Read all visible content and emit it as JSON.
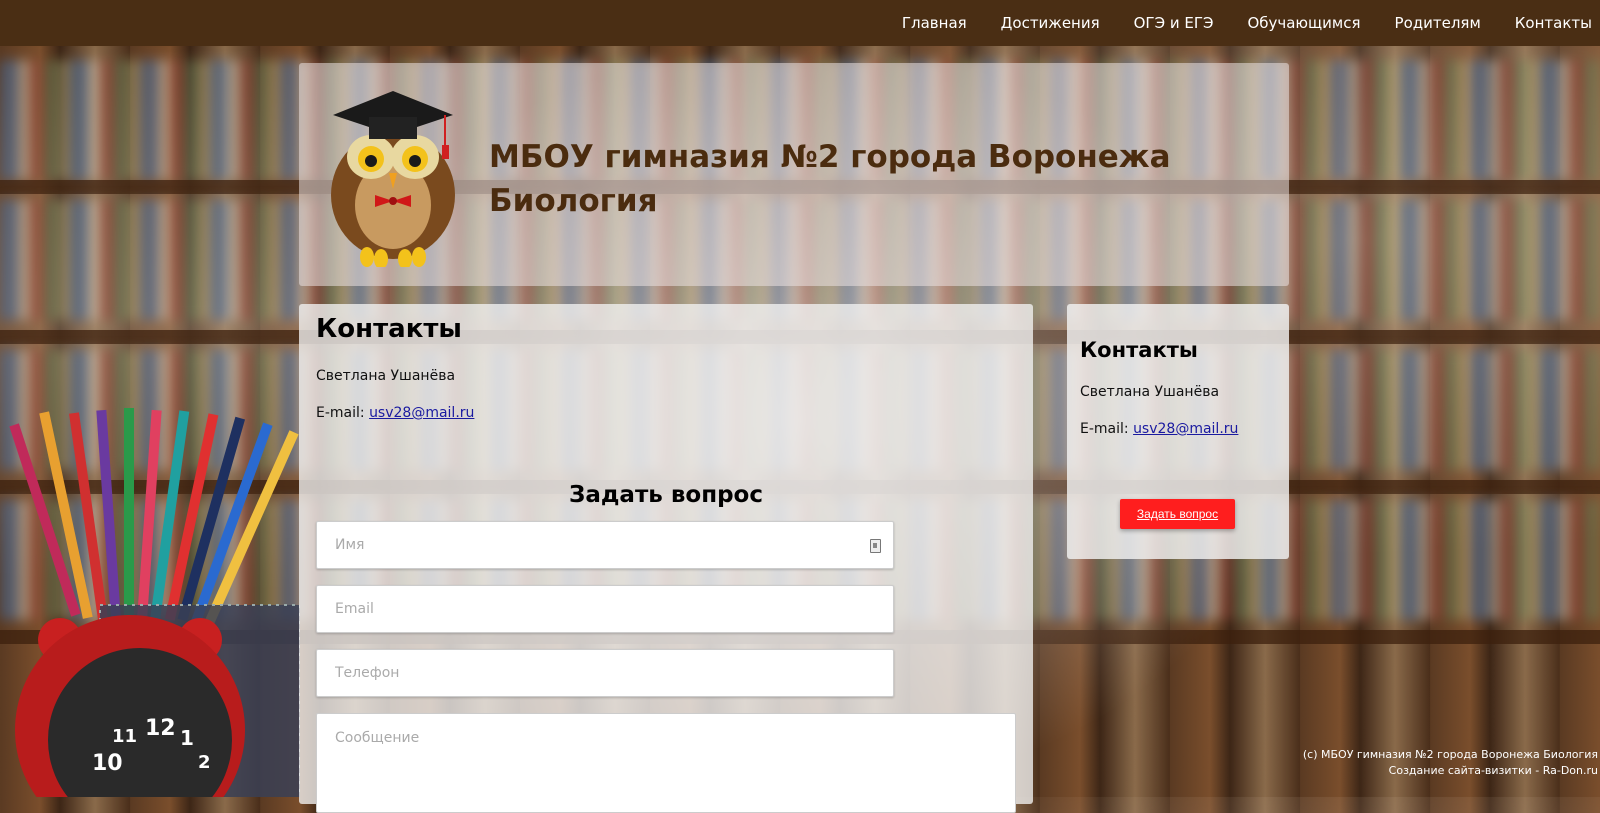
{
  "nav": {
    "items": [
      "Главная",
      "Достижения",
      "ОГЭ и ЕГЭ",
      "Обучающимся",
      "Родителям",
      "Контакты"
    ]
  },
  "header": {
    "title_line1": "МБОУ гимназия №2 города Воронежа",
    "title_line2": "Биология"
  },
  "main": {
    "heading": "Контакты",
    "name": "Светлана Ушанёва",
    "email_label": "E-mail: ",
    "email": "usv28@mail.ru",
    "form": {
      "title": "Задать вопрос",
      "name_placeholder": "Имя",
      "email_placeholder": "Email",
      "phone_placeholder": "Телефон",
      "message_placeholder": "Сообщение"
    }
  },
  "sidebar": {
    "heading": "Контакты",
    "name": "Светлана Ушанёва",
    "email_label": "E-mail: ",
    "email": "usv28@mail.ru",
    "button": "Задать вопрос"
  },
  "footer": {
    "line1": "(c) МБОУ гимназия №2 города Воронежа Биология",
    "line2": "Создание сайта-визитки - Ra-Don.ru"
  },
  "colors": {
    "nav_bg": "#4a2e14",
    "title": "#4b2c0f",
    "button": "#ff1e1e",
    "link": "#1a1aa0"
  }
}
